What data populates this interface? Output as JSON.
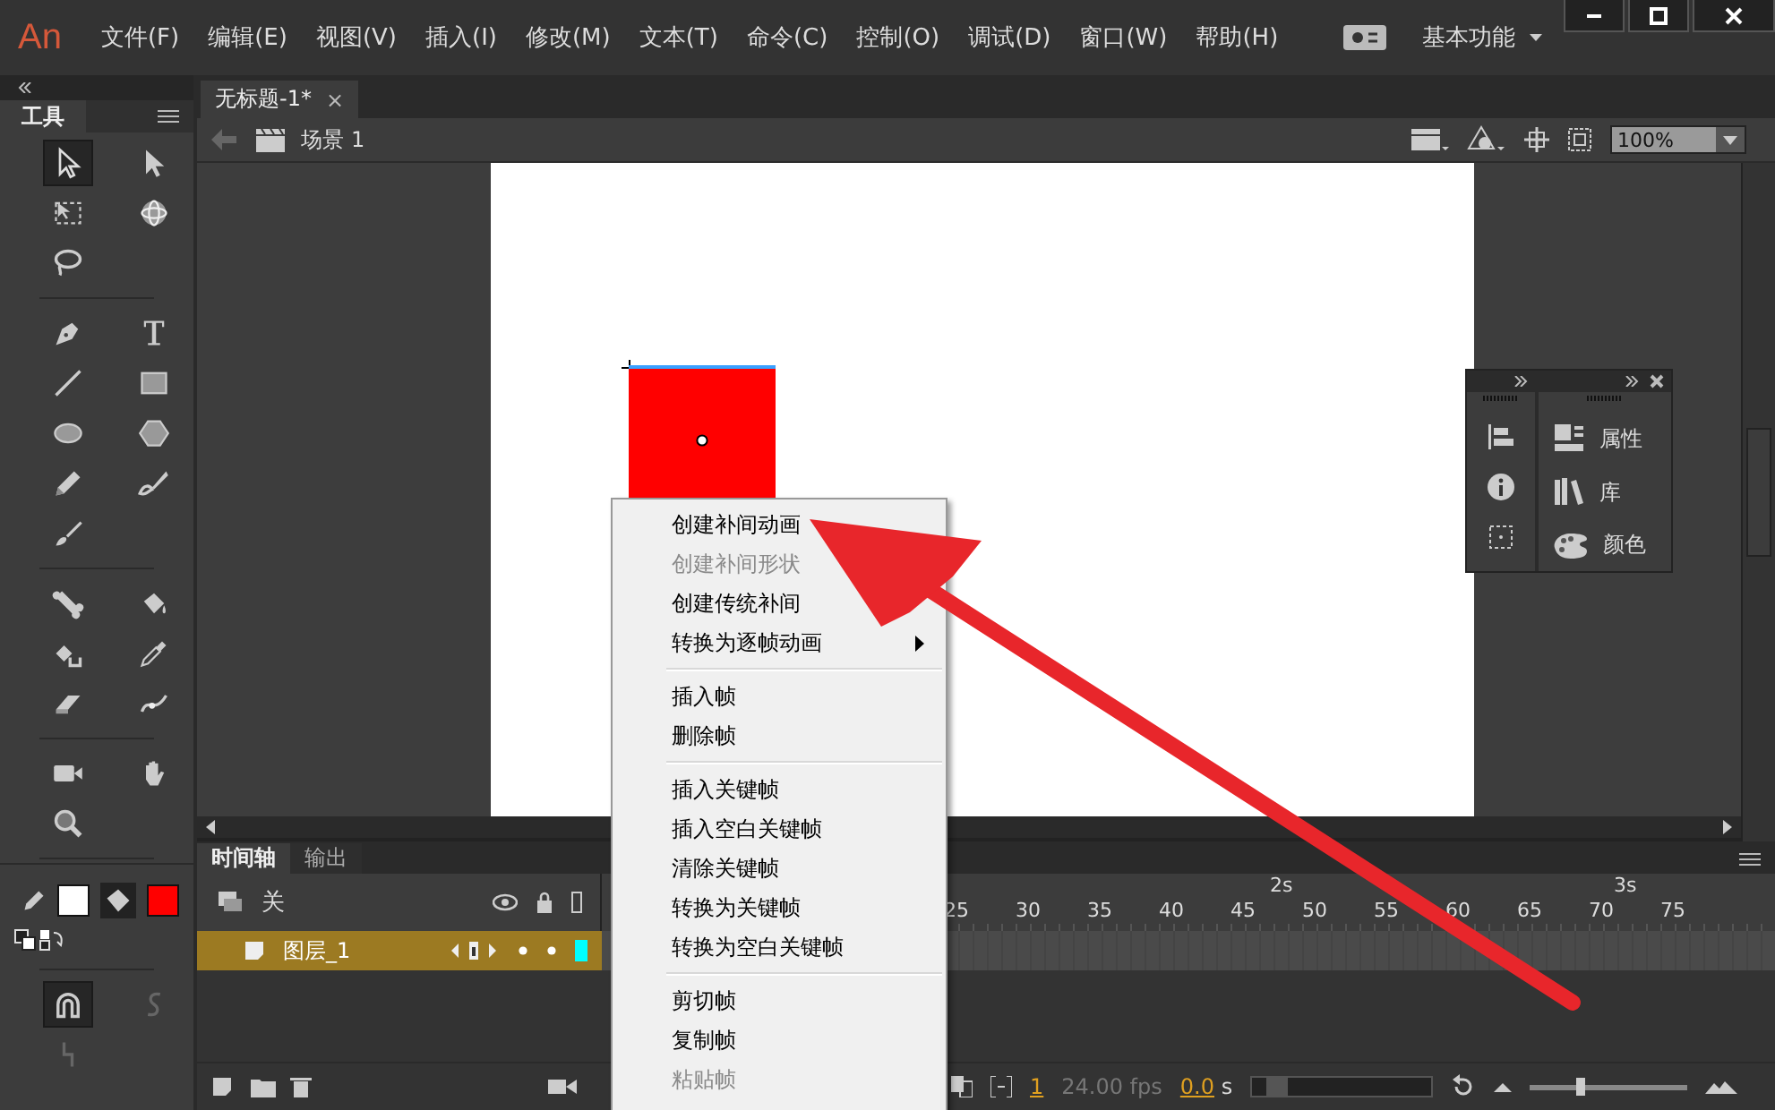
{
  "app": {
    "logo": "An",
    "menus": [
      "文件(F)",
      "编辑(E)",
      "视图(V)",
      "插入(I)",
      "修改(M)",
      "文本(T)",
      "命令(C)",
      "控制(O)",
      "调试(D)",
      "窗口(W)",
      "帮助(H)"
    ],
    "workspace": "基本功能"
  },
  "tools_panel": {
    "title": "工具",
    "groups": [
      [
        {
          "selected": true
        },
        {
          "selected": false
        },
        {
          "selected": false
        },
        {
          "selected": false
        },
        {
          "selected": false
        }
      ],
      [
        {
          "selected": false
        },
        {
          "selected": false
        },
        {
          "selected": false
        },
        {
          "selected": false
        },
        {
          "selected": false
        },
        {
          "selected": false
        },
        {
          "selected": false
        },
        {
          "selected": false
        },
        {
          "selected": false
        }
      ],
      [
        {
          "selected": false
        },
        {
          "selected": false
        },
        {
          "selected": false
        },
        {
          "selected": false
        },
        {
          "selected": false
        },
        {
          "selected": false
        }
      ],
      [
        {
          "selected": false
        },
        {
          "selected": false
        },
        {
          "selected": false
        }
      ]
    ],
    "swatches": [
      {
        "kind": "stroke",
        "color": "#ffffff"
      },
      {
        "kind": "fill",
        "color": "#ff0000"
      }
    ],
    "options": [
      {
        "selected": true
      },
      {
        "selected": false
      },
      {
        "selected": false
      }
    ]
  },
  "document_tab": {
    "title": "无标题-1*",
    "close": "×"
  },
  "scene": {
    "label": "场景",
    "number": "1",
    "zoom": "100%"
  },
  "floating_panel": {
    "items": [
      {
        "label": "属性"
      },
      {
        "label": "库"
      },
      {
        "label": "颜色"
      }
    ]
  },
  "timeline": {
    "tabs": [
      {
        "label": "时间轴",
        "selected": true
      },
      {
        "label": "输出",
        "selected": false
      }
    ],
    "header_label": "关",
    "seconds": [
      "2s",
      "3s"
    ],
    "ruler": [
      "25",
      "30",
      "35",
      "40",
      "45",
      "50",
      "55",
      "60",
      "65",
      "70",
      "75"
    ],
    "layers": [
      {
        "name": "图层_1",
        "selected": true
      }
    ],
    "current_frame": "1",
    "zoom_slider": {
      "level": 0.3
    },
    "fps": "24.00 fps",
    "time": "0.0",
    "time_unit": "s"
  },
  "context_menu": {
    "items": [
      {
        "kind": "item",
        "label": "创建补间动画",
        "disabled": false,
        "submenu": false
      },
      {
        "kind": "item",
        "label": "创建补间形状",
        "disabled": true,
        "submenu": false
      },
      {
        "kind": "item",
        "label": "创建传统补间",
        "disabled": false,
        "submenu": false
      },
      {
        "kind": "item",
        "label": "转换为逐帧动画",
        "disabled": false,
        "submenu": true
      },
      {
        "kind": "separator"
      },
      {
        "kind": "item",
        "label": "插入帧",
        "disabled": false,
        "submenu": false
      },
      {
        "kind": "item",
        "label": "删除帧",
        "disabled": false,
        "submenu": false
      },
      {
        "kind": "separator"
      },
      {
        "kind": "item",
        "label": "插入关键帧",
        "disabled": false,
        "submenu": false
      },
      {
        "kind": "item",
        "label": "插入空白关键帧",
        "disabled": false,
        "submenu": false
      },
      {
        "kind": "item",
        "label": "清除关键帧",
        "disabled": false,
        "submenu": false
      },
      {
        "kind": "item",
        "label": "转换为关键帧",
        "disabled": false,
        "submenu": false
      },
      {
        "kind": "item",
        "label": "转换为空白关键帧",
        "disabled": false,
        "submenu": false
      },
      {
        "kind": "separator"
      },
      {
        "kind": "item",
        "label": "剪切帧",
        "disabled": false,
        "submenu": false
      },
      {
        "kind": "item",
        "label": "复制帧",
        "disabled": false,
        "submenu": false
      },
      {
        "kind": "item",
        "label": "粘贴帧",
        "disabled": true,
        "submenu": false
      }
    ]
  }
}
